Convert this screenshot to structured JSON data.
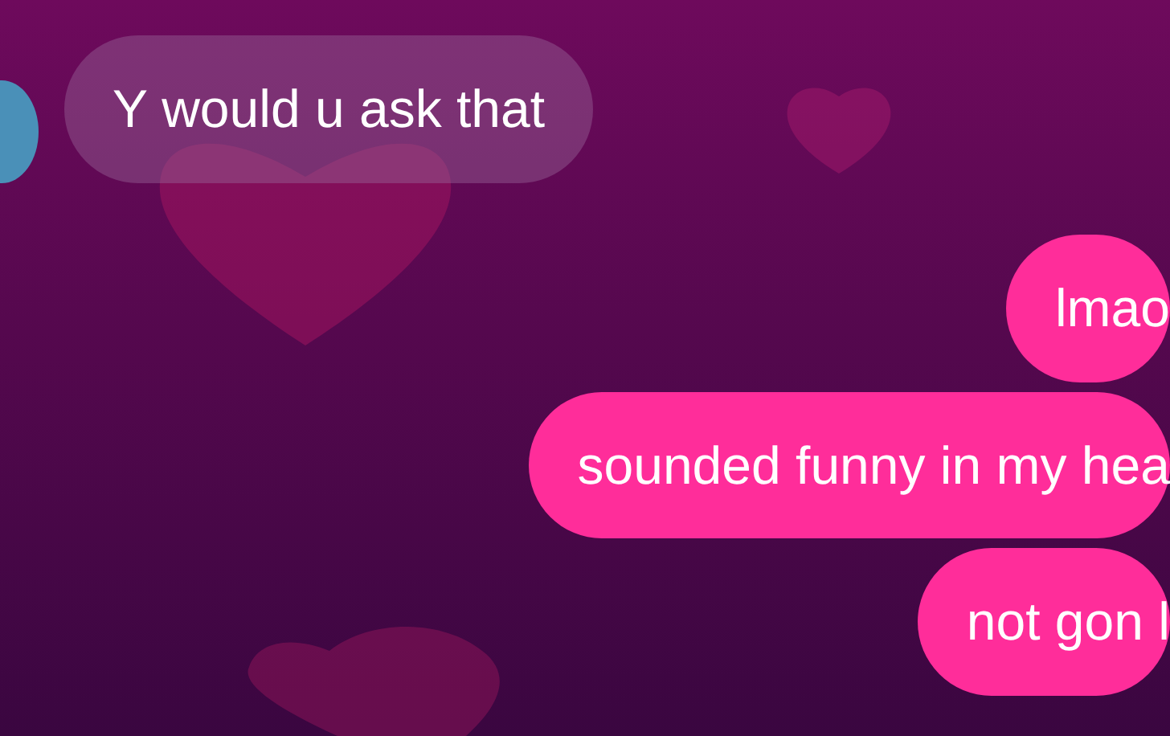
{
  "messages": [
    {
      "kind": "received",
      "text": "Y would u ask that",
      "avatar": true
    },
    {
      "kind": "sent",
      "text": "lmao"
    },
    {
      "kind": "sent",
      "text": "sounded funny in my hea"
    },
    {
      "kind": "sent",
      "text": "not gon l"
    }
  ]
}
